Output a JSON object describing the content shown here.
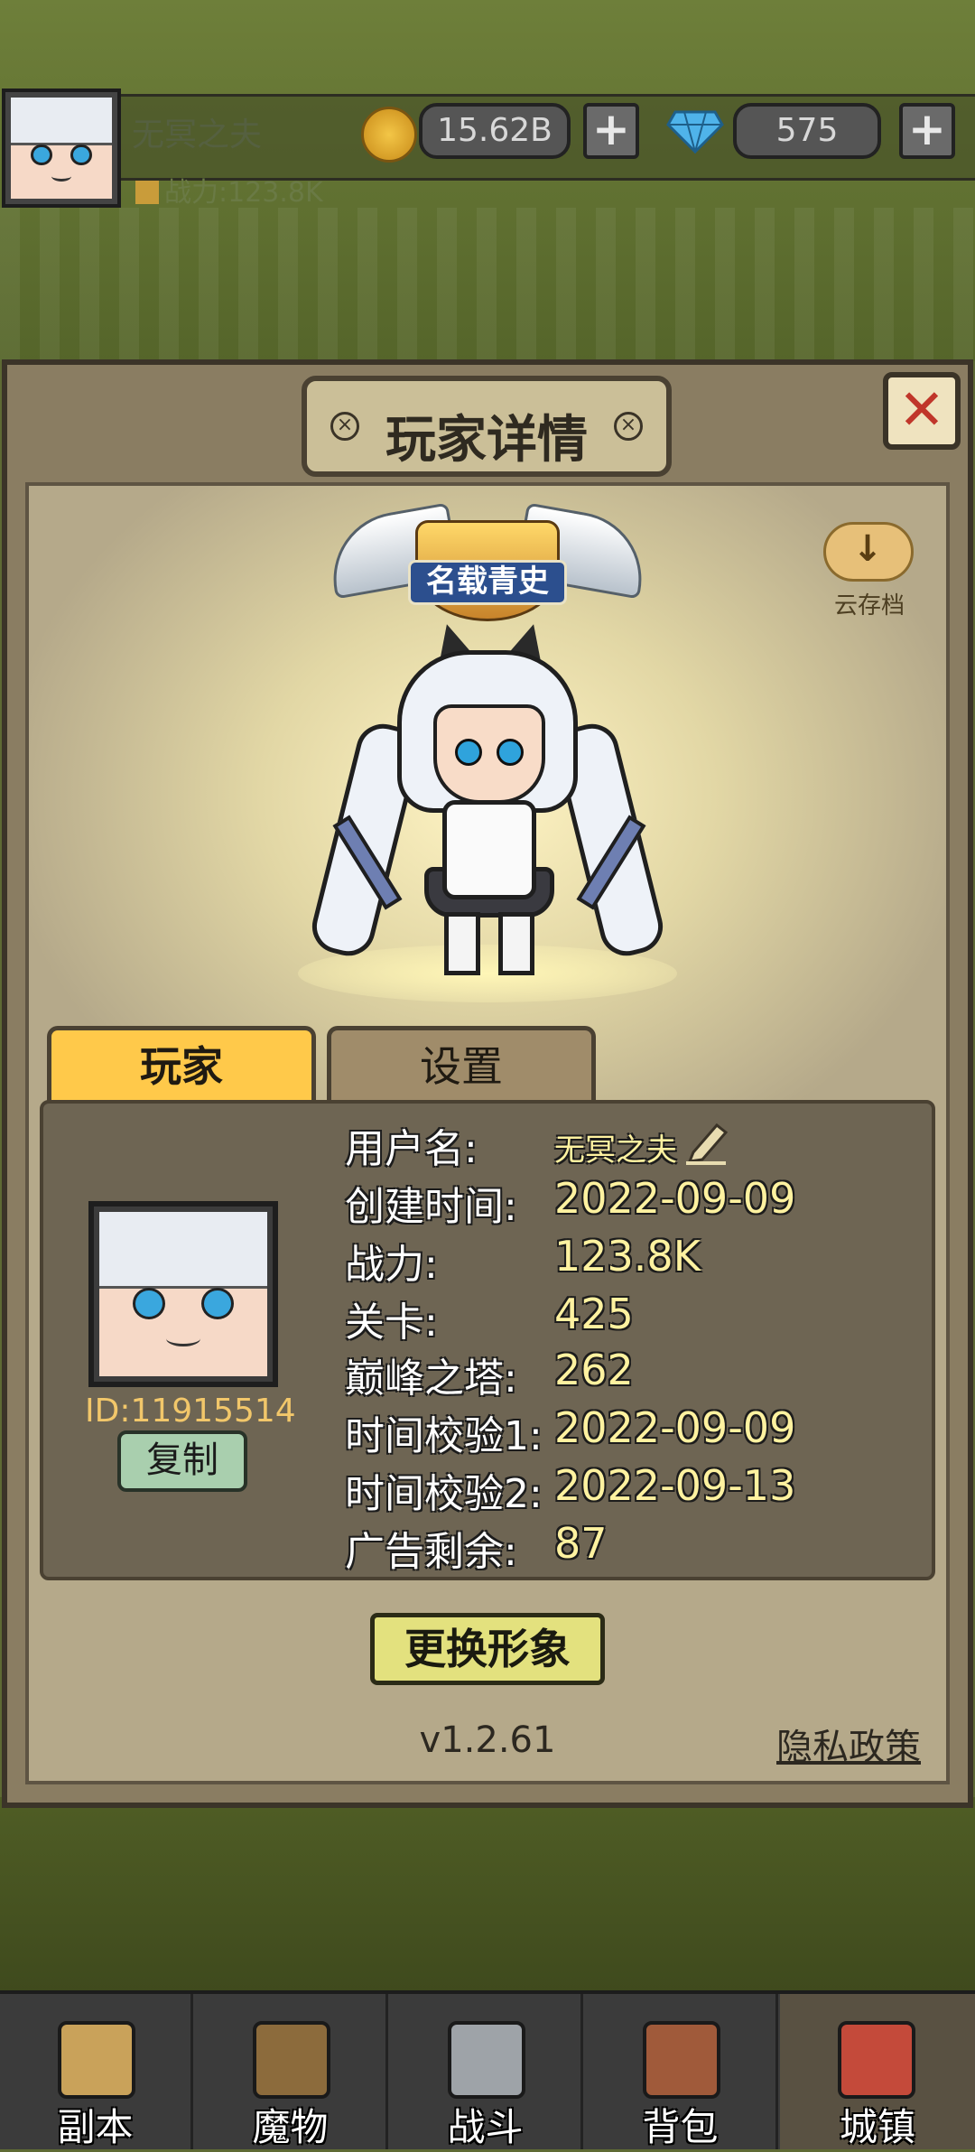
{
  "header": {
    "player_name": "无冥之夫",
    "power_label": "战力:123.8K",
    "gold_amount": "15.62B",
    "gem_amount": "575",
    "gold_icon": "gold-coin-icon",
    "gem_icon": "diamond-icon",
    "plus_symbol": "+"
  },
  "dialog": {
    "title": "玩家详情",
    "close_symbol": "✕",
    "title_badge": "名载青史",
    "cloud_save_label": "云存档",
    "tabs": [
      {
        "label": "玩家",
        "active": true
      },
      {
        "label": "设置",
        "active": false
      }
    ],
    "player_id": "ID:11915514",
    "copy_label": "复制",
    "info": [
      {
        "key": "用户名:",
        "value": "无冥之夫"
      },
      {
        "key": "创建时间:",
        "value": "2022-09-09"
      },
      {
        "key": "战力:",
        "value": "123.8K"
      },
      {
        "key": "关卡:",
        "value": "425"
      },
      {
        "key": "巅峰之塔:",
        "value": "262"
      },
      {
        "key": "时间校验1:",
        "value": "2022-09-09"
      },
      {
        "key": "时间校验2:",
        "value": "2022-09-13"
      },
      {
        "key": "广告剩余:",
        "value": "87"
      }
    ],
    "change_avatar_label": "更换形象",
    "version": "v1.2.61",
    "privacy_label": "隐私政策"
  },
  "nav": {
    "items": [
      {
        "label": "副本",
        "icon": "map-icon"
      },
      {
        "label": "魔物",
        "icon": "monster-icon"
      },
      {
        "label": "战斗",
        "icon": "crossed-swords-icon"
      },
      {
        "label": "背包",
        "icon": "backpack-icon"
      },
      {
        "label": "城镇",
        "icon": "town-icon",
        "active": true
      }
    ]
  },
  "colors": {
    "accent_tab": "#ffc94a",
    "value_text": "#fff2a0",
    "close_x": "#c0362a",
    "badge_banner": "#2c4f8e"
  }
}
